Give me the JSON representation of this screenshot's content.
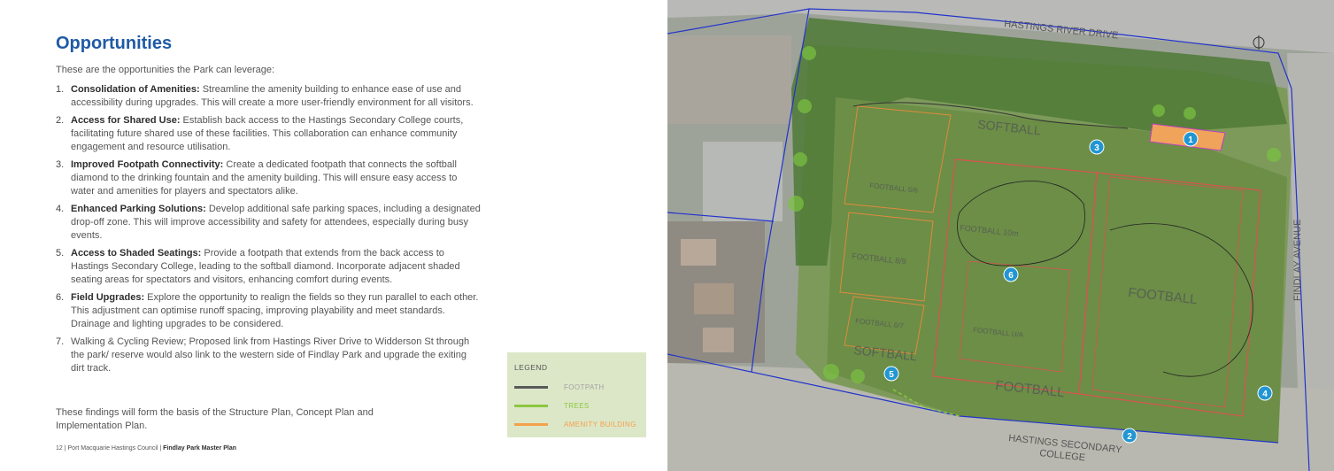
{
  "page": {
    "title": "Opportunities",
    "intro": "These are the opportunities the Park can leverage:",
    "items": [
      {
        "number": "1.",
        "label": "Consolidation of Amenities:",
        "text": " Streamline the amenity building to enhance ease of use and accessibility during upgrades. This will create a more user-friendly environment for all visitors."
      },
      {
        "number": "2.",
        "label": "Access for Shared Use:",
        "text": " Establish back access to the Hastings Secondary College courts, facilitating future shared use of these facilities. This collaboration can enhance community engagement and resource utilisation."
      },
      {
        "number": "3.",
        "label": "Improved Footpath Connectivity:",
        "text": " Create a dedicated footpath that connects the softball diamond to the drinking fountain and the amenity building. This will ensure easy access to water and amenities for players and spectators alike."
      },
      {
        "number": "4.",
        "label": "Enhanced Parking Solutions:",
        "text": " Develop additional safe parking spaces, including a designated drop-off zone. This will improve accessibility and safety for attendees, especially during busy events."
      },
      {
        "number": "5.",
        "label": "Access to Shaded Seatings:",
        "text": " Provide a footpath that extends from the back access to Hastings Secondary College, leading to the softball diamond. Incorporate adjacent shaded seating areas for spectators and visitors, enhancing comfort during events."
      },
      {
        "number": "6.",
        "label": "Field Upgrades:",
        "text": " Explore the opportunity to realign the fields so they run parallel to each other. This adjustment can optimise runoff spacing, improving playability and meet standards. Drainage and lighting upgrades to be considered."
      },
      {
        "number": "7.",
        "label": "",
        "text": "Walking & Cycling Review; Proposed link from Hastings River Drive to Widderson St through the park/ reserve would also link to the western side of Findlay Park and upgrade the exiting dirt track."
      }
    ],
    "closing": "These findings will form the basis of the Structure Plan, Concept Plan and Implementation Plan.",
    "footer": {
      "page_number": "12",
      "council": " | Port Macquarie Hastings Council | ",
      "doc_title": "Findlay Park Master Plan"
    }
  },
  "legend": {
    "title": "LEGEND",
    "items": [
      {
        "label": "FOOTPATH",
        "color": "#5a5a5a",
        "text_color": "#a3a3a3"
      },
      {
        "label": "TREES",
        "color": "#8cc63f",
        "text_color": "#8cc63f"
      },
      {
        "label": "AMENITY BUILDING",
        "color": "#f5a04a",
        "text_color": "#f5a04a"
      }
    ]
  },
  "map": {
    "labels": {
      "road_north": "HASTINGS RIVER DRIVE",
      "road_east": "FINDLAY AVENUE",
      "college": "HASTINGS SECONDARY COLLEGE",
      "college_line1": "HASTINGS SECONDARY",
      "college_line2": "COLLEGE",
      "softball": "SOFTBALL",
      "football": "FOOTBALL",
      "football_10m": "FOOTBALL 10m",
      "football_89": "FOOTBALL 8/9",
      "football_67": "FOOTBALL 6/7",
      "football_u": "FOOTBALL U/A",
      "football_small": "FOOTBALL 5/6"
    },
    "markers": [
      "1",
      "2",
      "3",
      "4",
      "5",
      "6"
    ],
    "colors": {
      "marker": "#2196d3",
      "boundary": "#2233cc",
      "field_red": "#d9534f",
      "field_orange": "#e08a3c",
      "grass": "#6c8e47"
    }
  }
}
